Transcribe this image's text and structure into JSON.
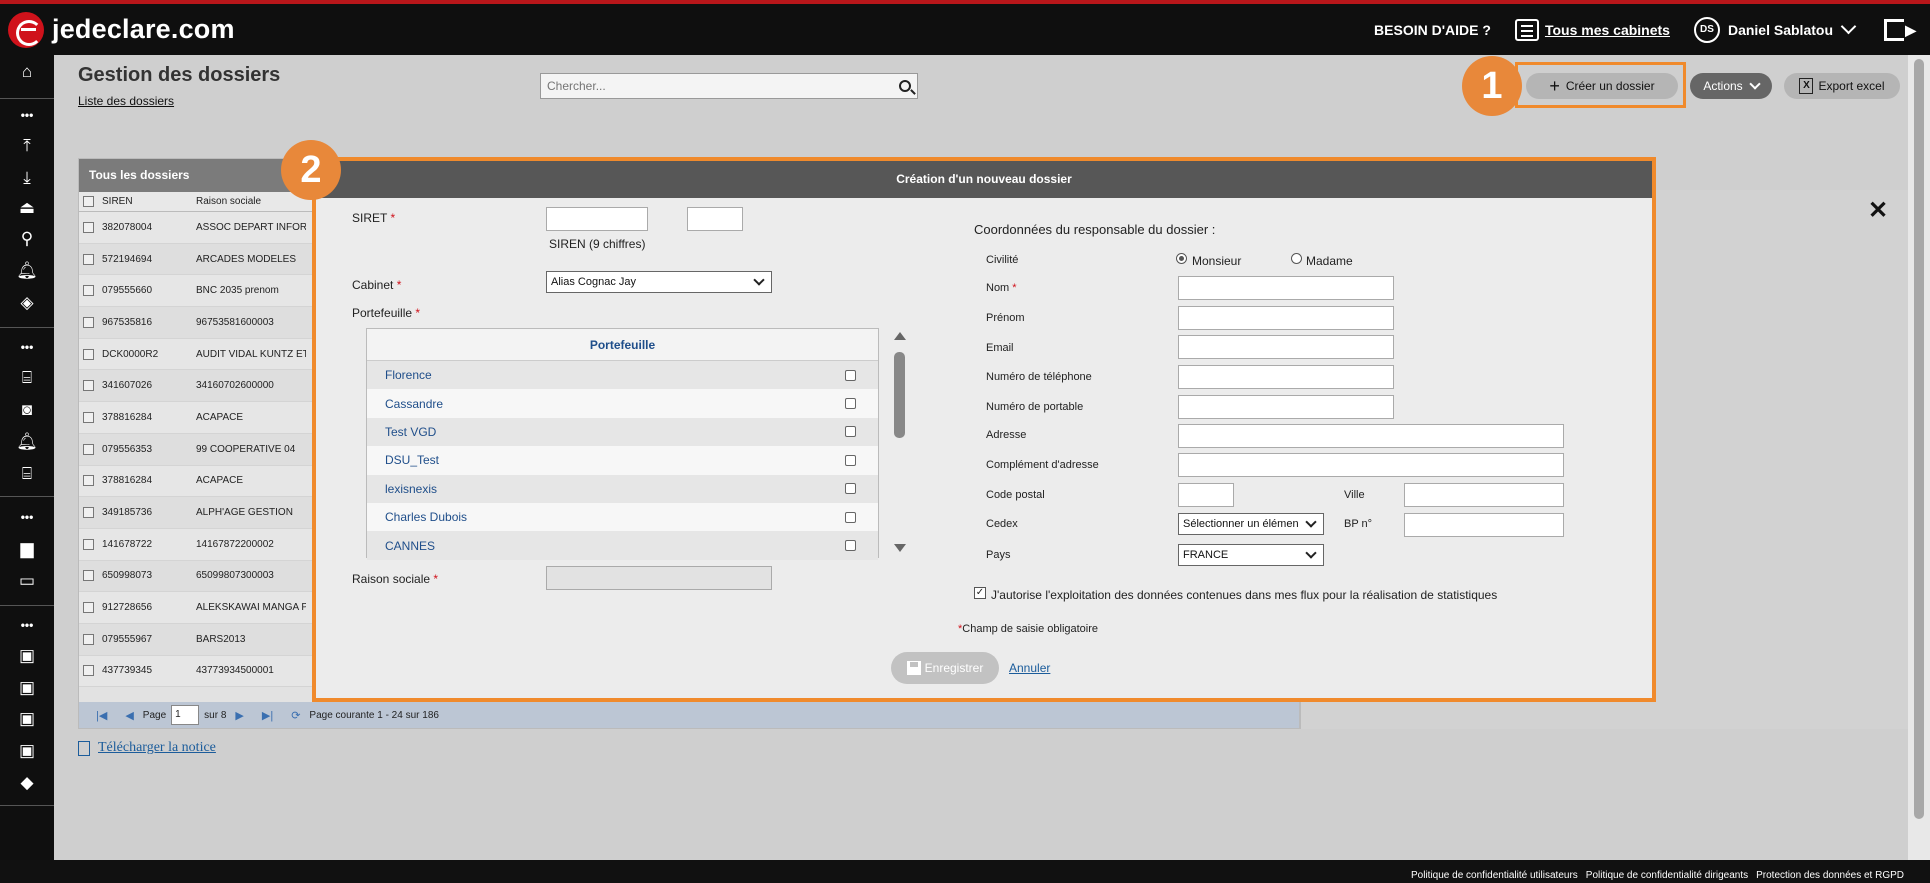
{
  "brand": {
    "name": "jedeclare.com"
  },
  "topbar": {
    "help": "BESOIN D'AIDE ?",
    "cabinets_link": "Tous mes cabinets",
    "user_initials": "DS",
    "user_name": "Daniel Sablatou"
  },
  "sidebar": {
    "items": [
      "home-icon",
      "more-icon",
      "upload-icon",
      "download-icon",
      "tray-icon",
      "network-icon",
      "bell-icon",
      "compass-icon",
      "more-icon",
      "bank-icon",
      "camera-icon",
      "bell-icon",
      "bank-icon",
      "more-icon",
      "folder-icon",
      "folder-open-icon",
      "more-icon",
      "stamp-icon",
      "stamp-icon",
      "stamp-icon",
      "stamp-icon",
      "layers-icon"
    ]
  },
  "page": {
    "title": "Gestion des dossiers",
    "breadcrumb": "Liste des dossiers",
    "search_placeholder": "Chercher...",
    "create_button": "Créer un dossier",
    "actions_button": "Actions",
    "export_button": "Export excel",
    "annotation_1": "1",
    "annotation_2": "2"
  },
  "table": {
    "title": "Tous les dossiers",
    "columns": [
      "SIREN",
      "Raison sociale"
    ],
    "rows": [
      [
        "382078004",
        "ASSOC DEPART INFORM"
      ],
      [
        "572194694",
        "ARCADES MODELES"
      ],
      [
        "079555660",
        "BNC 2035 prenom"
      ],
      [
        "967535816",
        "96753581600003"
      ],
      [
        "DCK0000R2",
        "AUDIT VIDAL KUNTZ ET"
      ],
      [
        "341607026",
        "34160702600000"
      ],
      [
        "378816284",
        "ACAPACE"
      ],
      [
        "079556353",
        "99 COOPERATIVE 04"
      ],
      [
        "378816284",
        "ACAPACE"
      ],
      [
        "349185736",
        "ALPH'AGE GESTION"
      ],
      [
        "141678722",
        "14167872200002"
      ],
      [
        "650998073",
        "65099807300003"
      ],
      [
        "912728656",
        "ALEKSKAWAI MANGA P"
      ],
      [
        "079555967",
        "BARS2013"
      ],
      [
        "437739345",
        "43773934500001"
      ]
    ],
    "pager": {
      "page_label": "Page",
      "page_value": "1",
      "of_label": "sur 8",
      "current": "Page courante 1 - 24 sur 186"
    }
  },
  "notice_link": "Télécharger la notice",
  "modal": {
    "title": "Création d'un nouveau dossier",
    "siret_label": "SIRET",
    "siren_hint": "SIREN (9 chiffres)",
    "cabinet_label": "Cabinet",
    "cabinet_value": "Alias Cognac Jay",
    "portefeuille_label": "Portefeuille",
    "portefeuille_header": "Portefeuille",
    "portefeuilles": [
      "Florence",
      "Cassandre",
      "Test VGD",
      "DSU_Test",
      "lexisnexis",
      "Charles Dubois",
      "CANNES"
    ],
    "raison_sociale_label": "Raison sociale",
    "responsable_title": "Coordonnées du responsable du dossier :",
    "civilite_label": "Civilité",
    "monsieur": "Monsieur",
    "madame": "Madame",
    "nom_label": "Nom",
    "prenom_label": "Prénom",
    "email_label": "Email",
    "tel_label": "Numéro de téléphone",
    "portable_label": "Numéro de portable",
    "adresse_label": "Adresse",
    "complement_label": "Complément d'adresse",
    "cp_label": "Code postal",
    "ville_label": "Ville",
    "cedex_label": "Cedex",
    "cedex_value": "Sélectionner un élémen",
    "bp_label": "BP n°",
    "pays_label": "Pays",
    "pays_value": "FRANCE",
    "consent_text": "J'autorise l'exploitation des données contenues dans mes flux pour la réalisation de statistiques",
    "required_note": "Champ de saisie obligatoire",
    "required_mark": "*",
    "save_button": "Enregistrer",
    "cancel_link": "Annuler"
  },
  "footer": {
    "links": [
      "Politique de confidentialité utilisateurs",
      "Politique de confidentialité dirigeants",
      "Protection des données et RGPD"
    ]
  }
}
